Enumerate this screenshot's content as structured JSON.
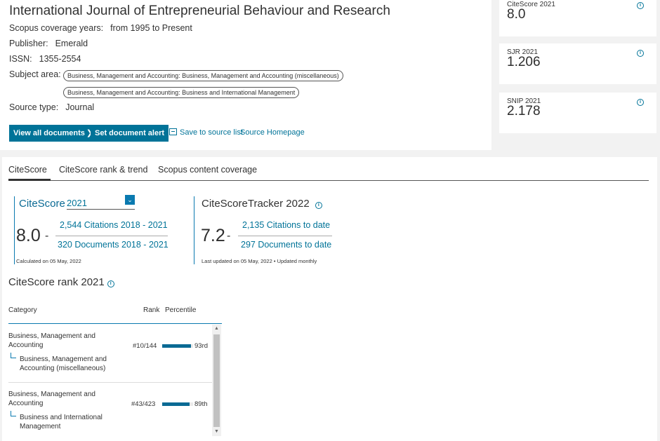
{
  "journal": {
    "title": "International Journal of Entrepreneurial Behaviour and Research",
    "coverage_label": "Scopus coverage years:",
    "coverage_value": "from 1995 to Present",
    "publisher_label": "Publisher:",
    "publisher_value": "Emerald",
    "issn_label": "ISSN:",
    "issn_value": "1355-2554",
    "subject_label": "Subject area:",
    "subjects": [
      "Business, Management and Accounting: Business, Management and Accounting (miscellaneous)",
      "Business, Management and Accounting: Business and International Management"
    ],
    "source_type_label": "Source type:",
    "source_type_value": "Journal"
  },
  "actions": {
    "view_all": "View all documents",
    "set_alert": "Set document alert",
    "save_to_list": "Save to source list",
    "homepage": "Source Homepage"
  },
  "metrics": [
    {
      "label": "CiteScore 2021",
      "value": "8.0"
    },
    {
      "label": "SJR 2021",
      "value": "1.206"
    },
    {
      "label": "SNIP 2021",
      "value": "2.178"
    }
  ],
  "tabs": [
    "CiteScore",
    "CiteScore rank & trend",
    "Scopus content coverage"
  ],
  "citescore": {
    "heading": "CiteScore",
    "year": "2021",
    "value": "8.0",
    "dash": "-",
    "citations_link": "2,544 Citations 2018 - 2021",
    "documents_link": "320 Documents 2018 - 2021",
    "calculated": "Calculated on 05 May, 2022"
  },
  "tracker": {
    "heading": "CiteScoreTracker 2022",
    "value": "7.2",
    "dash": "-",
    "citations_link": "2,135 Citations to date",
    "documents_link": "297 Documents to date",
    "updated": "Last updated on 05 May, 2022 • Updated monthly"
  },
  "rank": {
    "heading": "CiteScore rank 2021",
    "col_category": "Category",
    "col_rank": "Rank",
    "col_percentile": "Percentile",
    "rows": [
      {
        "category": "Business, Management and Accounting",
        "subcategory": "Business, Management and Accounting (miscellaneous)",
        "rank": "#10/144",
        "percentile": "93rd",
        "percentile_value": 93
      },
      {
        "category": "Business, Management and Accounting",
        "subcategory": "Business and International Management",
        "rank": "#43/423",
        "percentile": "89th",
        "percentile_value": 89
      }
    ]
  },
  "colors": {
    "accent": "#007398",
    "bar": "#0a6a94"
  }
}
